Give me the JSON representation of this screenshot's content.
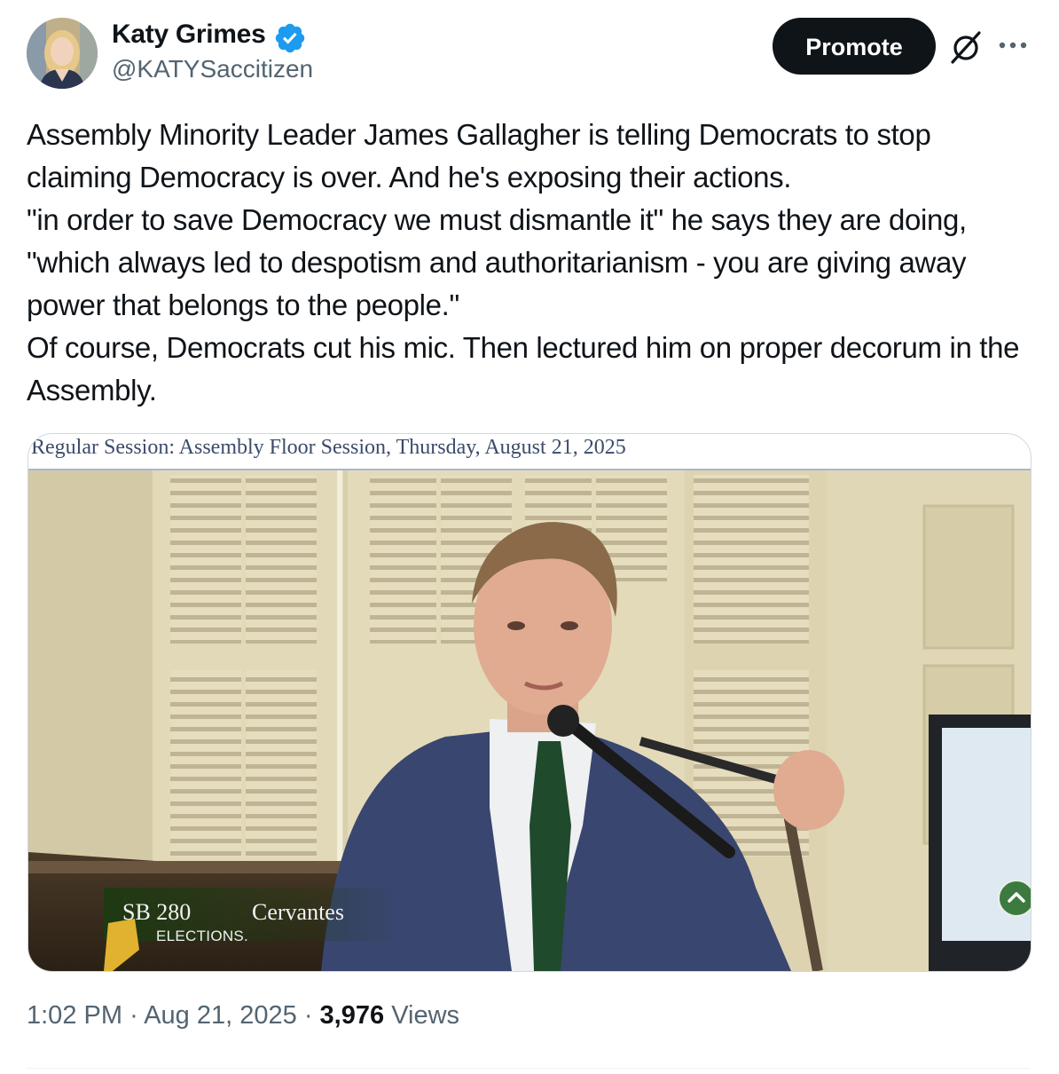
{
  "author": {
    "name": "Katy Grimes",
    "handle": "@KATYSaccitizen",
    "verified": true,
    "verified_color": "#1d9bf0"
  },
  "header": {
    "promote_label": "Promote",
    "grok_icon": "slashed-circle-icon",
    "more_icon": "more-dots-icon"
  },
  "tweet": {
    "text": "Assembly Minority Leader James Gallagher is telling Democrats to stop claiming Democracy is over. And he's exposing their actions.\n\"in order to save Democracy we must dismantle it\" he says they are doing, \"which always led to despotism and authoritarianism - you are giving away power that belongs to the people.\"\nOf course, Democrats cut his mic. Then lectured him on proper decorum in the Assembly."
  },
  "media": {
    "caption": "Regular Session: Assembly Floor Session, Thursday, August 21, 2025",
    "bill_number": "SB 280",
    "bill_author": "Cervantes",
    "bill_topic": "ELECTIONS."
  },
  "meta": {
    "time": "1:02 PM",
    "date": "Aug 21, 2025",
    "views_count": "3,976",
    "views_label": "Views",
    "separator": "·"
  },
  "colors": {
    "accent": "#0f1419",
    "secondary_text": "#536471",
    "border": "#cfd9de"
  }
}
